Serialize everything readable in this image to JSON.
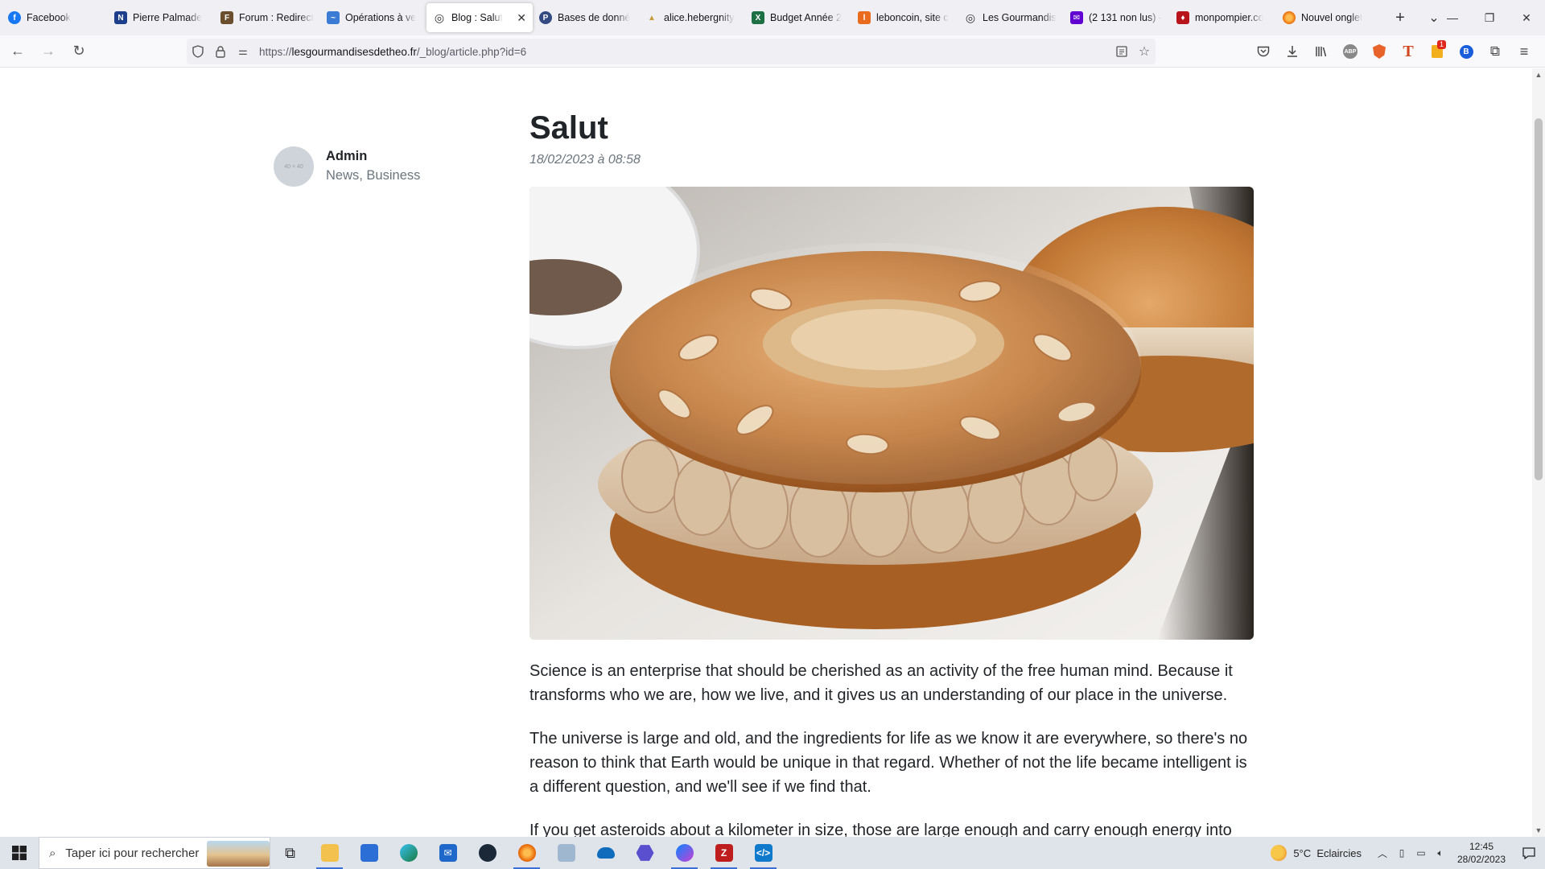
{
  "browser": {
    "tabs": [
      {
        "label": "Facebook",
        "icon": "facebook-icon",
        "color": "#1877f2",
        "glyph": "f"
      },
      {
        "label": "Pierre Palmade",
        "icon": "news-site-icon",
        "color": "#1d3e8a",
        "glyph": "N"
      },
      {
        "label": "Forum : Redirect",
        "icon": "forum-icon",
        "color": "#6b4e2e",
        "glyph": "F"
      },
      {
        "label": "Opérations à ve",
        "icon": "bank-icon",
        "color": "#3a7bd5",
        "glyph": "~"
      },
      {
        "label": "Blog : Salut",
        "icon": "globe-icon",
        "color": "#444",
        "glyph": "◎",
        "active": true
      },
      {
        "label": "Bases de donné",
        "icon": "phpmyadmin-icon",
        "color": "#334a82",
        "glyph": "P"
      },
      {
        "label": "alice.hebergnity",
        "icon": "hosting-icon",
        "color": "#c89a3a",
        "glyph": "▲"
      },
      {
        "label": "Budget Année 2",
        "icon": "excel-icon",
        "color": "#1d7044",
        "glyph": "X"
      },
      {
        "label": "leboncoin, site c",
        "icon": "leboncoin-icon",
        "color": "#ea6a1e",
        "glyph": "l"
      },
      {
        "label": "Les Gourmandis",
        "icon": "globe-icon",
        "color": "#444",
        "glyph": "◎"
      },
      {
        "label": "(2 131 non lus) -",
        "icon": "mail-icon",
        "color": "#6001d2",
        "glyph": "✉"
      },
      {
        "label": "monpompier.co",
        "icon": "pompier-icon",
        "color": "#b8141b",
        "glyph": "♦"
      },
      {
        "label": "Nouvel onglet",
        "icon": "firefox-icon",
        "color": "#e66000",
        "glyph": "◉"
      }
    ],
    "close_tab": "✕",
    "new_tab": "+",
    "list_all_tabs": "⌄",
    "window": {
      "minimize": "—",
      "restore": "❐",
      "close": "✕"
    },
    "url": {
      "scheme": "https://",
      "host": "lesgourmandisesdetheo.fr",
      "path": "/_blog/article.php?id=6"
    },
    "badge_count": "1"
  },
  "post": {
    "author": "Admin",
    "avatar_placeholder": "40 × 40",
    "categories": "News, Business",
    "title": "Salut",
    "date": "18/02/2023 à 08:58",
    "paragraphs": [
      "Science is an enterprise that should be cherished as an activity of the free human mind. Because it transforms who we are, how we live, and it gives us an understanding of our place in the universe.",
      "The universe is large and old, and the ingredients for life as we know it are everywhere, so there's no reason to think that Earth would be unique in that regard. Whether of not the life became intelligent is a different question, and we'll see if we find that.",
      "If you get asteroids about a kilometer in size, those are large enough and carry enough energy into"
    ]
  },
  "taskbar": {
    "search_placeholder": "Taper ici pour rechercher",
    "weather": "5°C  Eclaircies",
    "time": "12:45",
    "date": "28/02/2023"
  }
}
